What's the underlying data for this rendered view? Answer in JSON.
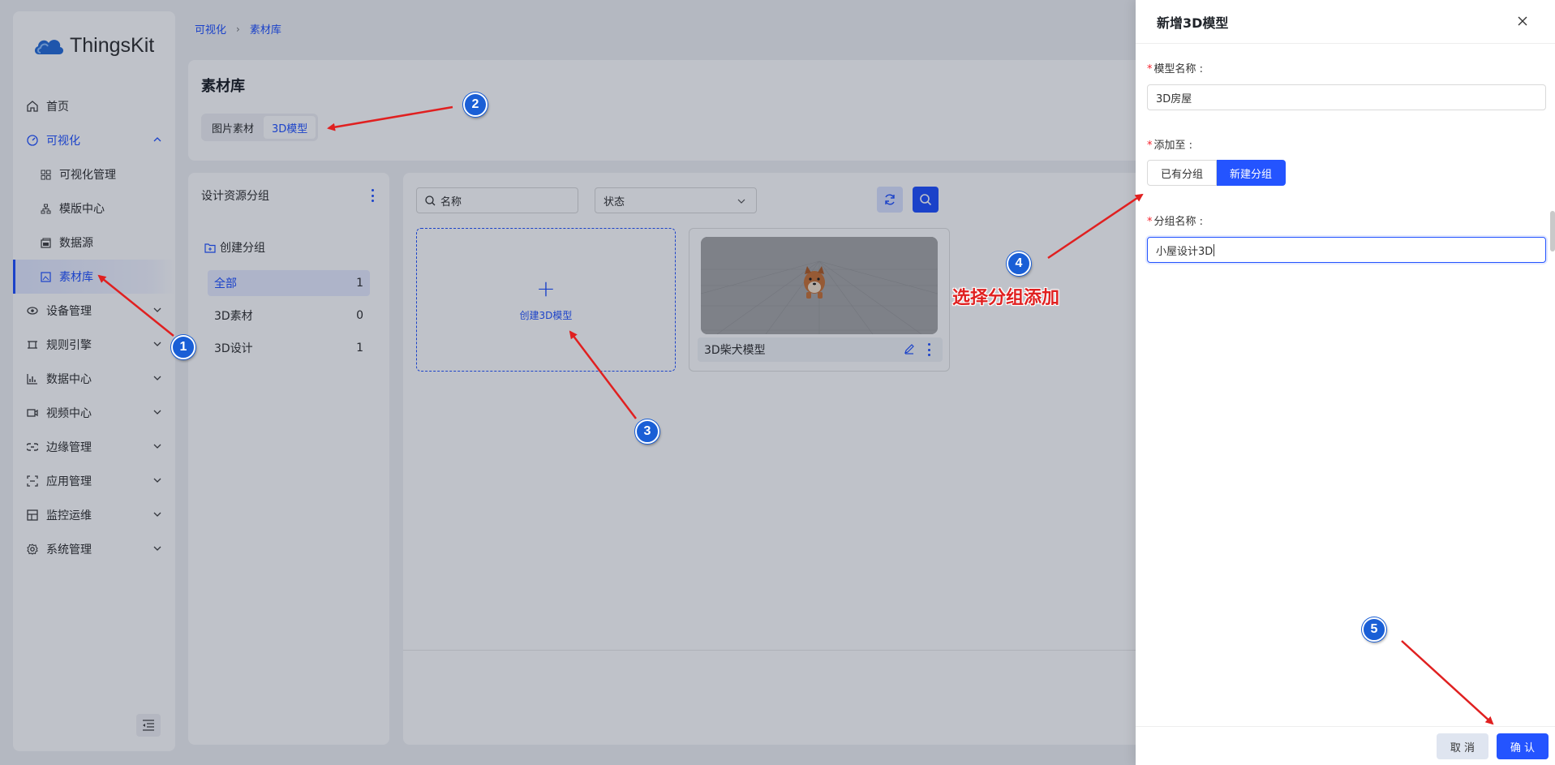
{
  "logo": {
    "text": "ThingsKit"
  },
  "nav": {
    "home": "首页",
    "visual": "可视化",
    "visual_mgmt": "可视化管理",
    "template_center": "模版中心",
    "datasource": "数据源",
    "material": "素材库",
    "device": "设备管理",
    "rule": "规则引擎",
    "data_center": "数据中心",
    "video": "视频中心",
    "edge": "边缘管理",
    "app": "应用管理",
    "monitor": "监控运维",
    "system": "系统管理"
  },
  "breadcrumb": {
    "parent": "可视化",
    "current": "素材库"
  },
  "page": {
    "title": "素材库",
    "tab_image": "图片素材",
    "tab_3d": "3D模型"
  },
  "group_panel": {
    "title": "设计资源分组",
    "create": "创建分组",
    "items": [
      {
        "name": "全部",
        "count": "1"
      },
      {
        "name": "3D素材",
        "count": "0"
      },
      {
        "name": "3D设计",
        "count": "1"
      }
    ]
  },
  "toolbar": {
    "search_placeholder": "名称",
    "status_placeholder": "状态"
  },
  "cards": {
    "create_label": "创建3D模型",
    "model_name": "3D柴犬模型"
  },
  "drawer": {
    "title": "新增3D模型",
    "model_name_label": "模型名称",
    "model_name_value": "3D房屋",
    "add_to_label": "添加至",
    "opt_existing": "已有分组",
    "opt_new": "新建分组",
    "group_name_label": "分组名称",
    "group_name_value": "小屋设计3D",
    "cancel": "取 消",
    "confirm": "确 认"
  },
  "annotations": {
    "badges": [
      "1",
      "2",
      "3",
      "4",
      "5"
    ],
    "note": "选择分组添加"
  },
  "colors": {
    "accent": "#2454ff",
    "annotation": "#e02020",
    "badge": "#1a5fd6"
  }
}
